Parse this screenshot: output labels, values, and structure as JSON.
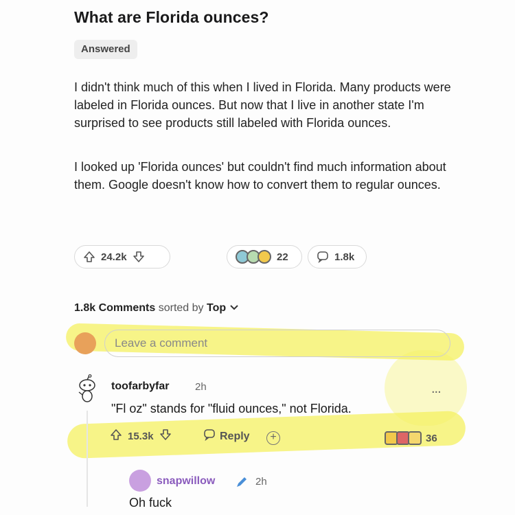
{
  "post": {
    "title": "What are Florida ounces?",
    "flair": "Answered",
    "paragraph_1": "I didn't think much of this when I lived in Florida. Many products were labeled in Florida ounces. But now that I live in another state I'm surprised to see products still labeled with Florida ounces.",
    "paragraph_2": "I looked up 'Florida ounces' but couldn't find much information about them. Google doesn't know how to convert them to regular ounces.",
    "votes": "24.2k",
    "awards": "22",
    "comments": "1.8k"
  },
  "comments_header": {
    "count": "1.8k Comments",
    "sorted_by": "sorted by",
    "sort_value": "Top"
  },
  "comment_box": {
    "placeholder": "Leave a comment"
  },
  "top_comment": {
    "username": "toofarbyfar",
    "time": "2h",
    "text": "\"Fl oz\" stands for \"fluid ounces,\" not Florida.",
    "votes": "15.3k",
    "reply_label": "Reply",
    "awards": "36",
    "more": "..."
  },
  "reply": {
    "username": "snapwillow",
    "time": "2h",
    "text": "Oh fuck"
  },
  "colors": {
    "highlight": "#f4f060",
    "reply_username": "#8a5bbd"
  }
}
